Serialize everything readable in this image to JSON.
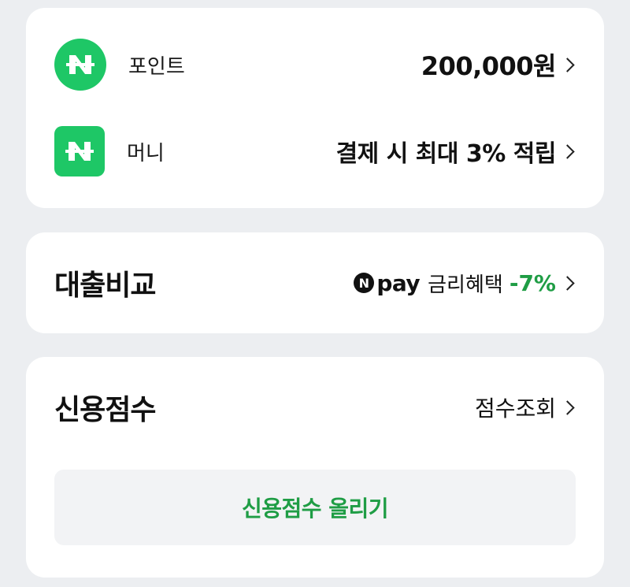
{
  "wallet": {
    "point": {
      "icon": "naver-n-circle-icon",
      "label": "포인트",
      "amount": "200,000원"
    },
    "money": {
      "icon": "naver-n-square-icon",
      "label": "머니",
      "benefit": "결제 시 최대 3% 적립"
    }
  },
  "loan": {
    "title": "대출비교",
    "badge_letter": "N",
    "brand": "pay",
    "desc": "금리혜택",
    "rate": "-7%"
  },
  "credit": {
    "title": "신용점수",
    "link": "점수조회",
    "button": "신용점수 올리기"
  },
  "colors": {
    "naver_green": "#1ec766",
    "accent_green": "#1f9d45",
    "background": "#eceef1",
    "card": "#ffffff"
  }
}
